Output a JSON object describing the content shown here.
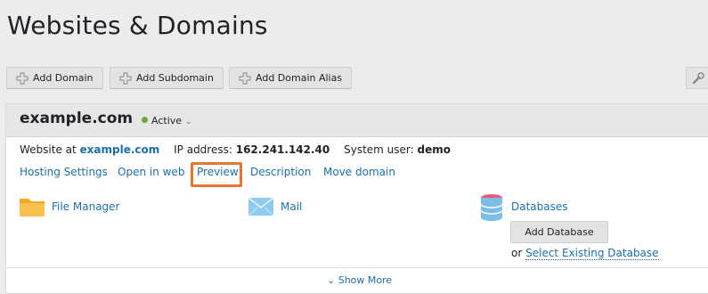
{
  "page": {
    "title": "Websites & Domains"
  },
  "toolbar": {
    "add_domain": "Add Domain",
    "add_subdomain": "Add Subdomain",
    "add_domain_alias": "Add Domain Alias"
  },
  "domain": {
    "name": "example.com",
    "status": "Active",
    "website_at_label": "Website at",
    "website_at_value": "example.com",
    "ip_label": "IP address:",
    "ip_value": "162.241.142.40",
    "system_user_label": "System user:",
    "system_user_value": "demo",
    "links": [
      "Hosting Settings",
      "Open in web",
      "Preview",
      "Description",
      "Move domain"
    ],
    "tiles": {
      "file_manager": "File Manager",
      "mail": "Mail",
      "databases": "Databases"
    },
    "add_database": "Add Database",
    "or_label": "or",
    "select_existing_db": "Select Existing Database",
    "show_more": "Show More"
  },
  "colors": {
    "link": "#1a6fb0",
    "highlight": "#e8752d",
    "status_active": "#6ea63a"
  },
  "icons": [
    "plus-icon",
    "wrench-icon",
    "folder-icon",
    "mail-icon",
    "database-icon",
    "chevron-down-icon"
  ]
}
